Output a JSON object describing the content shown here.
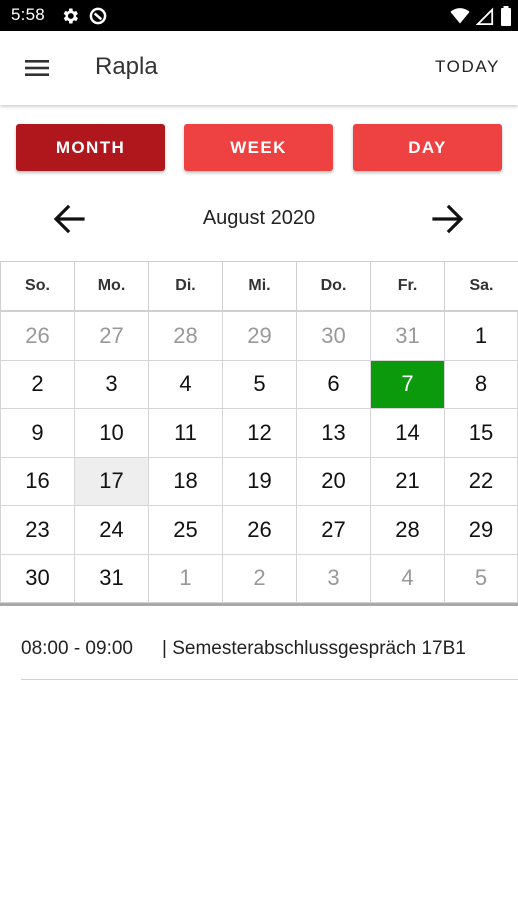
{
  "status_bar": {
    "time": "5:58",
    "icons": [
      "settings-icon",
      "app-indicator-icon",
      "wifi-icon",
      "signal-icon",
      "battery-icon"
    ]
  },
  "app_bar": {
    "title": "Rapla",
    "menu_icon": "menu-icon",
    "today_label": "TODAY"
  },
  "view_switcher": {
    "month_label": "MONTH",
    "week_label": "WEEK",
    "day_label": "DAY",
    "active": "MONTH",
    "active_color": "#b0171d",
    "inactive_color": "#ee4141"
  },
  "calendar": {
    "month_title": "August 2020",
    "prev_icon": "arrow-left-icon",
    "next_icon": "arrow-right-icon",
    "weekdays": [
      "So.",
      "Mo.",
      "Di.",
      "Mi.",
      "Do.",
      "Fr.",
      "Sa."
    ],
    "days": [
      {
        "label": "26",
        "outside": true
      },
      {
        "label": "27",
        "outside": true
      },
      {
        "label": "28",
        "outside": true
      },
      {
        "label": "29",
        "outside": true
      },
      {
        "label": "30",
        "outside": true
      },
      {
        "label": "31",
        "outside": true
      },
      {
        "label": "1"
      },
      {
        "label": "2"
      },
      {
        "label": "3"
      },
      {
        "label": "4"
      },
      {
        "label": "5"
      },
      {
        "label": "6"
      },
      {
        "label": "7",
        "today": true
      },
      {
        "label": "8"
      },
      {
        "label": "9"
      },
      {
        "label": "10"
      },
      {
        "label": "11"
      },
      {
        "label": "12"
      },
      {
        "label": "13"
      },
      {
        "label": "14"
      },
      {
        "label": "15"
      },
      {
        "label": "16"
      },
      {
        "label": "17",
        "selected": true
      },
      {
        "label": "18"
      },
      {
        "label": "19"
      },
      {
        "label": "20"
      },
      {
        "label": "21"
      },
      {
        "label": "22"
      },
      {
        "label": "23"
      },
      {
        "label": "24"
      },
      {
        "label": "25"
      },
      {
        "label": "26"
      },
      {
        "label": "27"
      },
      {
        "label": "28"
      },
      {
        "label": "29"
      },
      {
        "label": "30"
      },
      {
        "label": "31"
      },
      {
        "label": "1",
        "outside": true
      },
      {
        "label": "2",
        "outside": true
      },
      {
        "label": "3",
        "outside": true
      },
      {
        "label": "4",
        "outside": true
      },
      {
        "label": "5",
        "outside": true
      }
    ],
    "today_color": "#0b9a0b",
    "selected_color": "#eeeeee"
  },
  "events": [
    {
      "time": "08:00 - 09:00",
      "title": "| Semesterabschlussgespräch 17B1"
    }
  ]
}
